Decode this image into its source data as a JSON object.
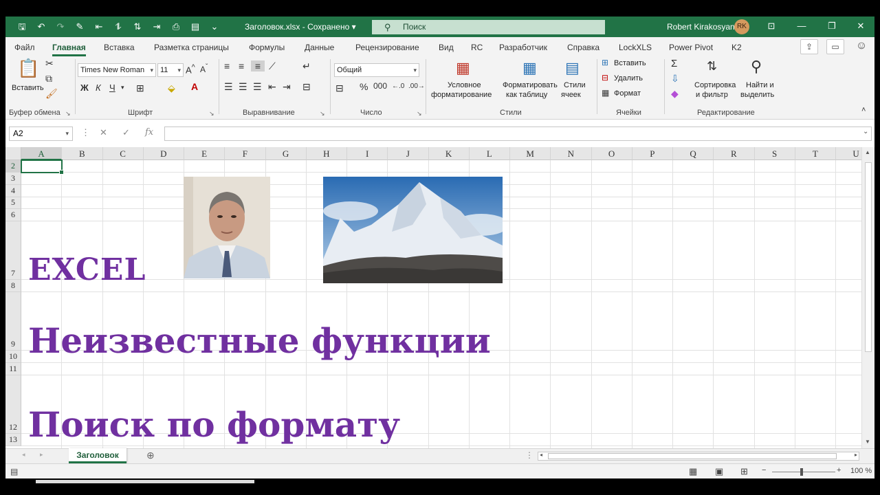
{
  "titlebar": {
    "title": "Заголовок.xlsx  -  Сохранено  ▾",
    "search_placeholder": "Поиск",
    "user_name": "Robert Kirakosyan",
    "user_initials": "RK"
  },
  "tabs": [
    "Файл",
    "Главная",
    "Вставка",
    "Разметка страницы",
    "Формулы",
    "Данные",
    "Рецензирование",
    "Вид",
    "RC",
    "Разработчик",
    "Справка",
    "LockXLS",
    "Power Pivot",
    "K2"
  ],
  "ribbon": {
    "clipboard": {
      "paste": "Вставить",
      "label": "Буфер обмена"
    },
    "font": {
      "name": "Times New Roman",
      "size": "11",
      "bold": "Ж",
      "italic": "К",
      "underline": "Ч",
      "label": "Шрифт"
    },
    "alignment": {
      "label": "Выравнивание"
    },
    "number": {
      "format": "Общий",
      "label": "Число"
    },
    "styles": {
      "conditional_1": "Условное",
      "conditional_2": "форматирование",
      "as_table_1": "Форматировать",
      "as_table_2": "как таблицу",
      "cell_styles_1": "Стили",
      "cell_styles_2": "ячеек",
      "label": "Стили"
    },
    "cells": {
      "insert": "Вставить",
      "delete": "Удалить",
      "format": "Формат",
      "label": "Ячейки"
    },
    "editing": {
      "sort_1": "Сортировка",
      "sort_2": "и фильтр",
      "find_1": "Найти и",
      "find_2": "выделить",
      "label": "Редактирование"
    }
  },
  "formula_bar": {
    "name_box": "A2",
    "fx": "fx",
    "value": ""
  },
  "columns": [
    "A",
    "B",
    "C",
    "D",
    "E",
    "F",
    "G",
    "H",
    "I",
    "J",
    "K",
    "L",
    "M",
    "N",
    "O",
    "P",
    "Q",
    "R",
    "S",
    "T",
    "U"
  ],
  "rows": [
    "2",
    "3",
    "4",
    "5",
    "6",
    "7",
    "8",
    "9",
    "10",
    "11",
    "12",
    "13"
  ],
  "cells": {
    "A7": "EXCEL",
    "A9": "Неизвестные функции",
    "A12": "Поиск по формату"
  },
  "sheets": [
    "Заголовок"
  ],
  "status": {
    "zoom": "100 %"
  },
  "colors": {
    "excel_green": "#217346",
    "text_purple": "#7030a0"
  }
}
